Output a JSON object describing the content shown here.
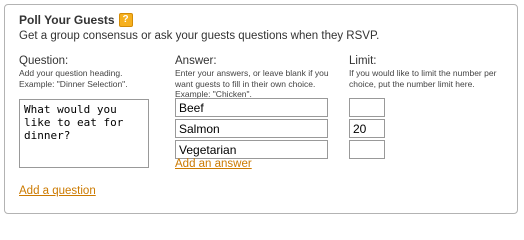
{
  "title": "Poll Your Guests",
  "help_icon": {
    "glyph": "?",
    "name": "help-icon"
  },
  "subtitle": "Get a group consensus or ask your guests questions when they RSVP.",
  "columns": {
    "question": {
      "label": "Question:",
      "help_line1": "Add your question heading.",
      "help_line2": "Example: \"Dinner Selection\"."
    },
    "answer": {
      "label": "Answer:",
      "help_line1": "Enter your answers, or leave blank if you",
      "help_line2": "want guests to fill in their own choice.",
      "help_line3": "Example: \"Chicken\"."
    },
    "limit": {
      "label": "Limit:",
      "help_line1": "If you would like to limit the number per",
      "help_line2": "choice, put the number limit here."
    }
  },
  "question_value": "What would you like to eat for dinner?",
  "answers": [
    {
      "value": "Beef",
      "limit": ""
    },
    {
      "value": "Salmon",
      "limit": "20"
    },
    {
      "value": "Vegetarian",
      "limit": ""
    }
  ],
  "add_answer_label": "Add an answer",
  "add_question_label": "Add a question",
  "colors": {
    "link": "#cc7a00",
    "help_icon": "#f6b01e",
    "border": "#b3b3b3"
  }
}
